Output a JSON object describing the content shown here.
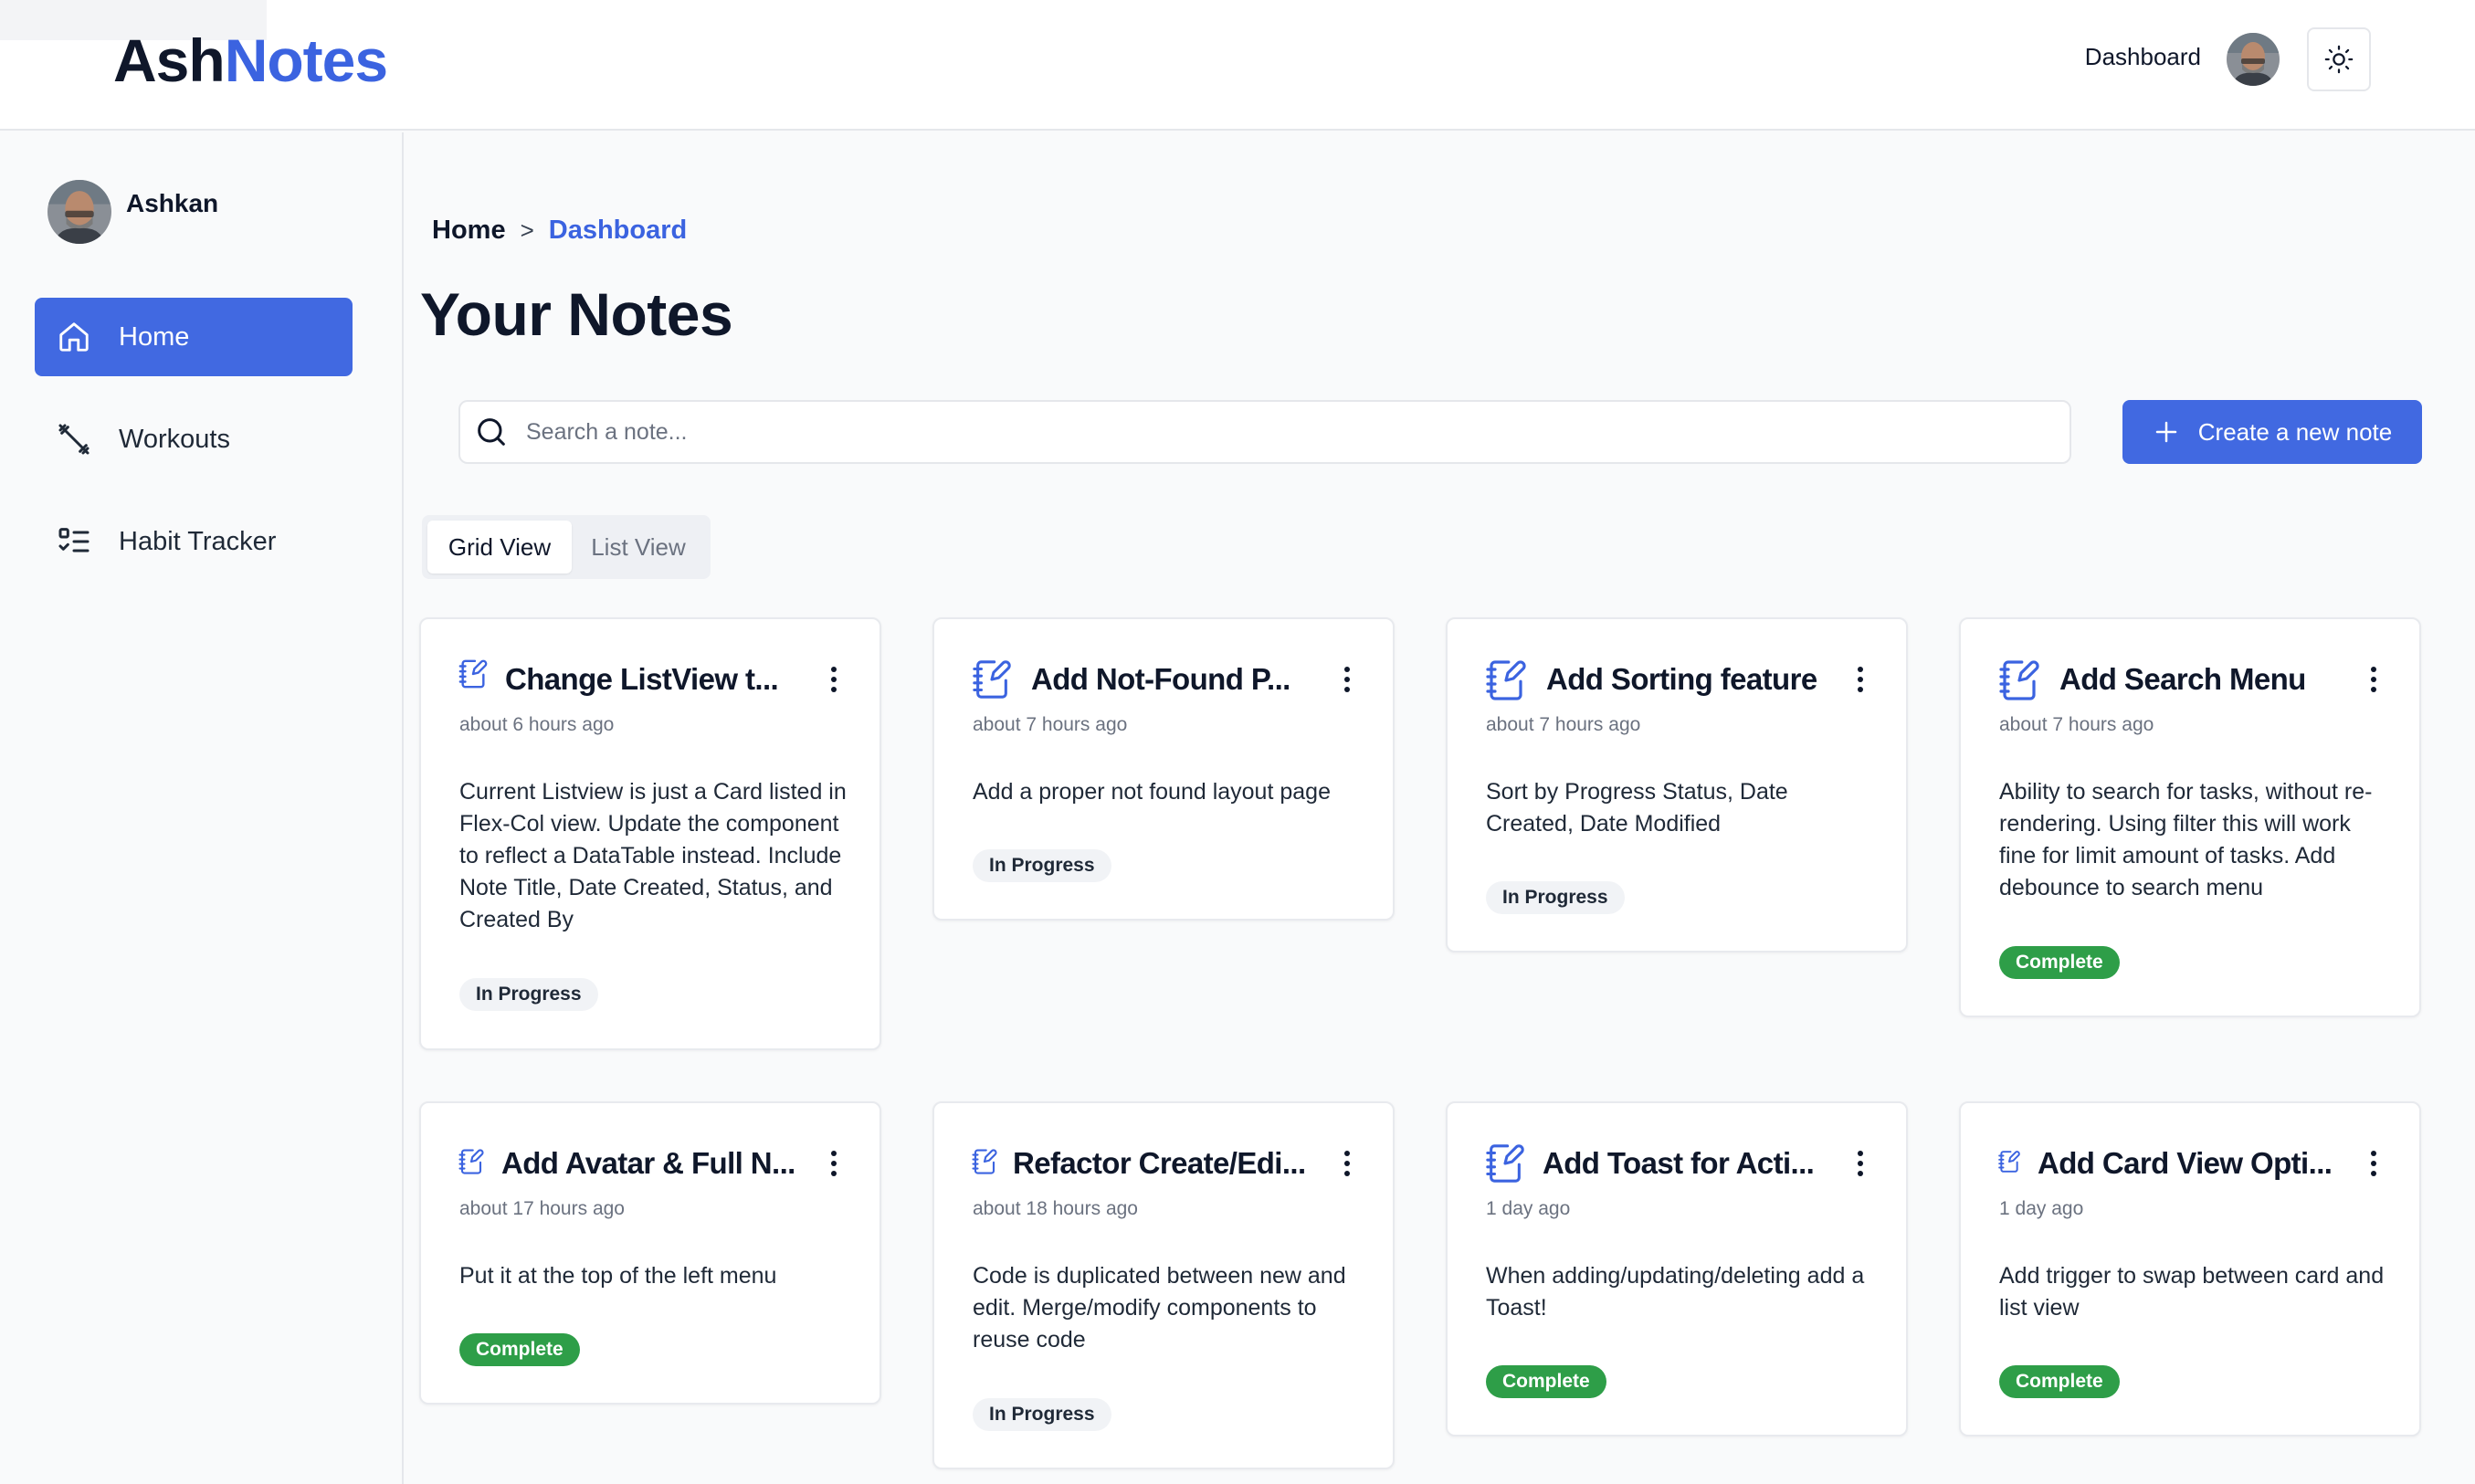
{
  "header": {
    "logo_part1": "Ash",
    "logo_part2": "Notes",
    "nav_dashboard": "Dashboard"
  },
  "sidebar": {
    "user_name": "Ashkan",
    "items": [
      {
        "label": "Home",
        "icon": "home-icon",
        "active": true
      },
      {
        "label": "Workouts",
        "icon": "dumbbell-icon",
        "active": false
      },
      {
        "label": "Habit Tracker",
        "icon": "checklist-icon",
        "active": false
      }
    ]
  },
  "breadcrumb": {
    "home": "Home",
    "separator": ">",
    "current": "Dashboard"
  },
  "page_title": "Your Notes",
  "search": {
    "placeholder": "Search a note...",
    "value": ""
  },
  "create_button": {
    "label": "Create a new note",
    "icon": "plus-icon"
  },
  "view_tabs": {
    "grid": "Grid View",
    "list": "List View",
    "selected": "Grid View"
  },
  "colors": {
    "accent": "#4169e1",
    "brand_blue": "#3b63e0",
    "complete": "#2e9e48"
  },
  "notes": [
    {
      "title": "Change ListView t...",
      "time": "about 6 hours ago",
      "description": "Current Listview is just a Card listed in Flex-Col view. Update the component to reflect a DataTable instead. Include Note Title, Date Created, Status, and Created By",
      "status": "In Progress"
    },
    {
      "title": "Add Not-Found P...",
      "time": "about 7 hours ago",
      "description": "Add a proper not found layout page",
      "status": "In Progress"
    },
    {
      "title": "Add Sorting feature",
      "time": "about 7 hours ago",
      "description": "Sort by Progress Status, Date Created, Date Modified",
      "status": "In Progress"
    },
    {
      "title": "Add Search Menu",
      "time": "about 7 hours ago",
      "description": "Ability to search for tasks, without re-rendering. Using filter this will work fine for limit amount of tasks. Add debounce to search menu",
      "status": "Complete"
    },
    {
      "title": "Add Avatar & Full N...",
      "time": "about 17 hours ago",
      "description": "Put it at the top of the left menu",
      "status": "Complete"
    },
    {
      "title": "Refactor Create/Edi...",
      "time": "about 18 hours ago",
      "description": "Code is duplicated between new and edit. Merge/modify components to reuse code",
      "status": "In Progress"
    },
    {
      "title": "Add Toast for Acti...",
      "time": "1 day ago",
      "description": "When adding/updating/deleting add a Toast!",
      "status": "Complete"
    },
    {
      "title": "Add Card View Opti...",
      "time": "1 day ago",
      "description": "Add trigger to swap between card and list view",
      "status": "Complete"
    }
  ]
}
